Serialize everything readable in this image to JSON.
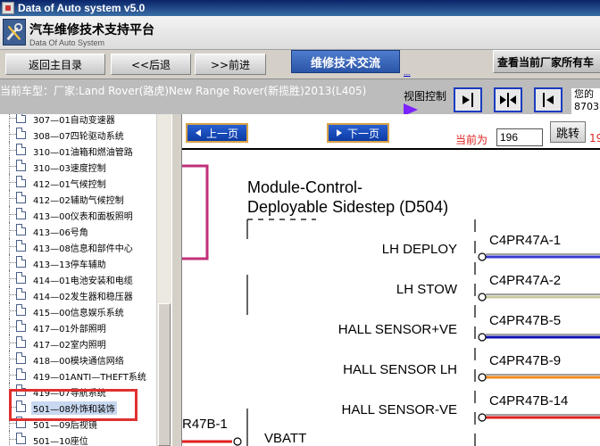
{
  "window": {
    "title": "Data of Auto system v5.0"
  },
  "header": {
    "brand_cn": "汽车维修技术支持平台",
    "brand_en": "Data Of Auto System"
  },
  "nav": {
    "home": "返回主目录",
    "back": "<<后退",
    "forward": ">>前进",
    "forum": "维修技术交流",
    "forum_link": "...",
    "query": "查看当前厂家所有车"
  },
  "info": {
    "vehicle": "当前车型：厂家:Land Rover(路虎)New Range Rover(新揽胜)2013(L405)",
    "view_control": "视图控制",
    "greeting_line1": "您的",
    "greeting_line2": "8703"
  },
  "tree": {
    "items": [
      "307—01自动变速器",
      "308—07四轮驱动系统",
      "310—01油箱和燃油管路",
      "310—03速度控制",
      "412—01气候控制",
      "412—02辅助气候控制",
      "413—00仪表和面板照明",
      "413—06号角",
      "413—08信息和部件中心",
      "413—13停车辅助",
      "414—01电池安装和电缆",
      "414—02发生器和稳压器",
      "415—00信息娱乐系统",
      "417—01外部照明",
      "417—02室内照明",
      "418—00模块通信网络",
      "419—01ANTI—THEFT系统",
      "419—07导航系统",
      "501—08外饰和装饰",
      "501—09后视镜",
      "501—10座位"
    ],
    "selected_index": 18
  },
  "pager": {
    "prev": "上一页",
    "next": "下一页",
    "current_label": "当前为",
    "current_value": "196",
    "go": "跳转",
    "total": "19"
  },
  "diagram": {
    "title_line1": "Module-Control-",
    "title_line2": "Deployable Sidestep (D504)",
    "left_ref": "R47B-1",
    "left_pin_label": "VBATT",
    "pins": [
      {
        "label": "LH DEPLOY",
        "connector": "C4PR47A-1",
        "wire_color": "#3a3ad0"
      },
      {
        "label": "LH STOW",
        "connector": "C4PR47A-2",
        "wire_color": "#c9c9a0"
      },
      {
        "label": "HALL SENSOR+VE",
        "connector": "C4PR47B-5",
        "wire_color": "#1010b0"
      },
      {
        "label": "HALL SENSOR LH",
        "connector": "C4PR47B-9",
        "wire_color": "#f08a1a"
      },
      {
        "label": "HALL SENSOR-VE",
        "connector": "C4PR47B-14",
        "wire_color": "#e02020"
      }
    ]
  }
}
